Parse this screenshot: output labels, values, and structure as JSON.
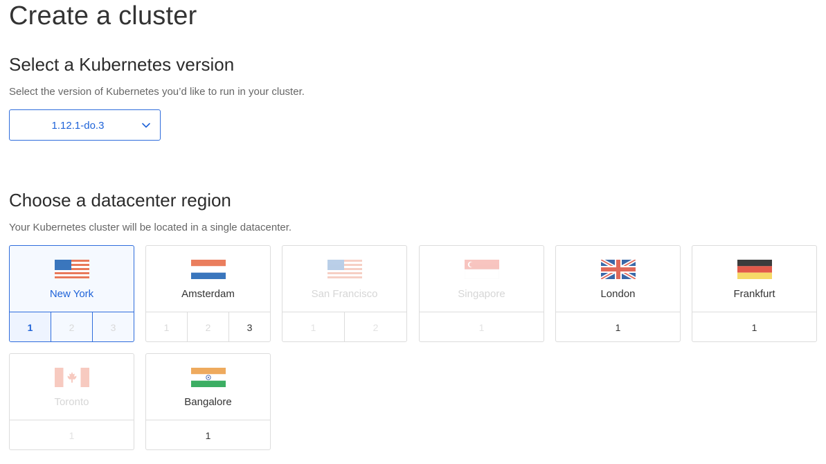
{
  "page_title": "Create a cluster",
  "version_section": {
    "title": "Select a Kubernetes version",
    "description": "Select the version of Kubernetes you’d like to run in your cluster.",
    "selected_version": "1.12.1-do.3"
  },
  "region_section": {
    "title": "Choose a datacenter region",
    "description": "Your Kubernetes cluster will be located in a single datacenter."
  },
  "regions": [
    {
      "name": "New York",
      "flag": "us-flag",
      "state": "selected",
      "datacenters": [
        "1",
        "2",
        "3"
      ],
      "selected_datacenter": "1"
    },
    {
      "name": "Amsterdam",
      "flag": "nl-flag",
      "state": "available",
      "datacenters": [
        "1",
        "2",
        "3"
      ],
      "available_datacenters": [
        "3"
      ]
    },
    {
      "name": "San Francisco",
      "flag": "us-flag",
      "state": "disabled",
      "datacenters": [
        "1",
        "2"
      ]
    },
    {
      "name": "Singapore",
      "flag": "sg-flag",
      "state": "disabled",
      "datacenters": [
        "1"
      ]
    },
    {
      "name": "London",
      "flag": "uk-flag",
      "state": "available",
      "datacenters": [
        "1"
      ]
    },
    {
      "name": "Frankfurt",
      "flag": "de-flag",
      "state": "available",
      "datacenters": [
        "1"
      ]
    },
    {
      "name": "Toronto",
      "flag": "ca-flag",
      "state": "disabled",
      "datacenters": [
        "1"
      ]
    },
    {
      "name": "Bangalore",
      "flag": "in-flag",
      "state": "available",
      "datacenters": [
        "1"
      ]
    }
  ],
  "colors": {
    "accent": "#2e6cdc",
    "border": "#dcdcdc",
    "selected_bg": "#f5f9ff"
  }
}
